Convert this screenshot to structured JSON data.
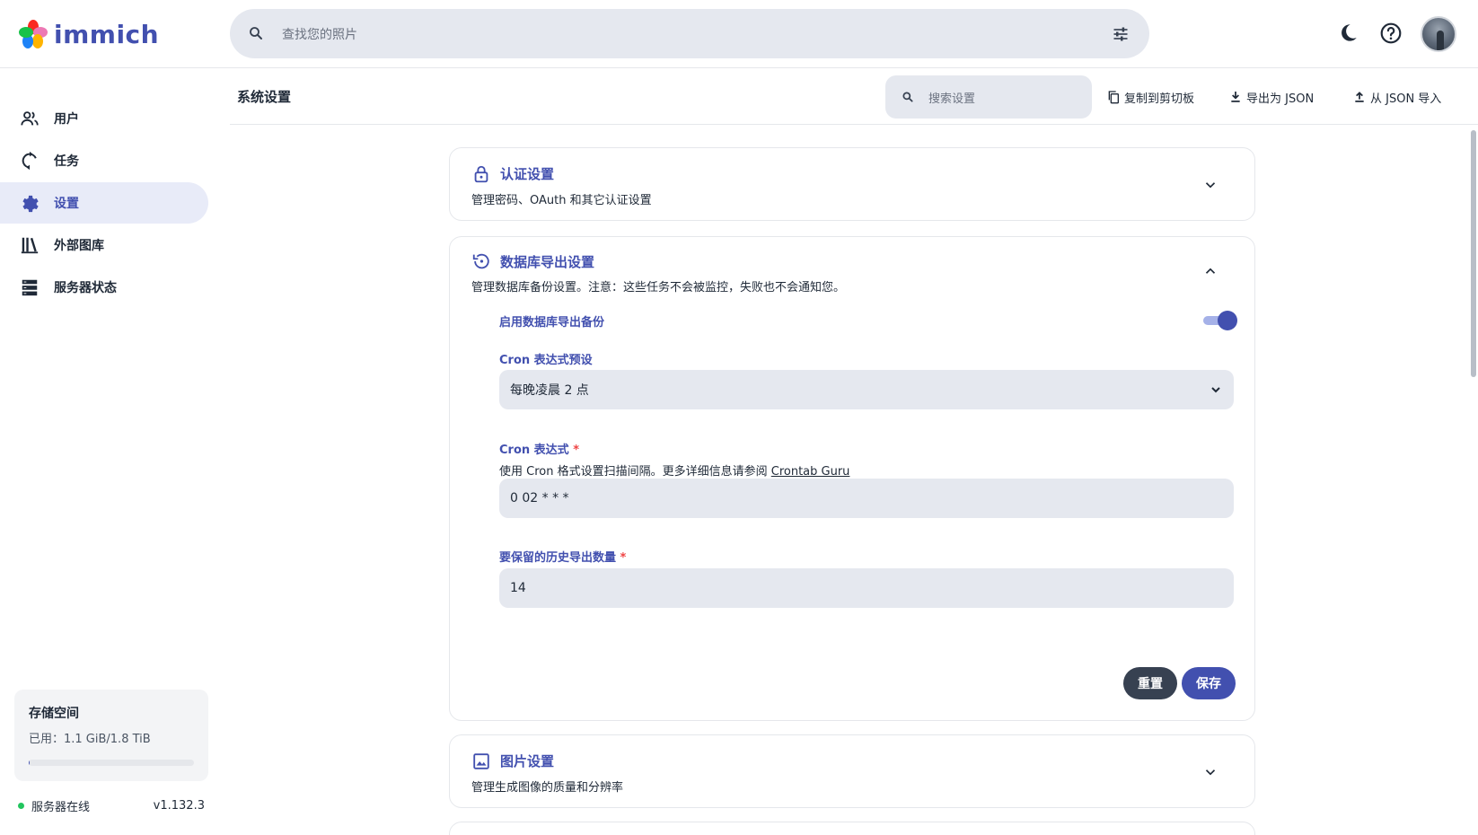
{
  "app": {
    "name": "immich"
  },
  "top_search": {
    "placeholder": "查找您的照片"
  },
  "sidebar": {
    "items": [
      {
        "label": "用户",
        "icon": "users-icon"
      },
      {
        "label": "任务",
        "icon": "sync-icon"
      },
      {
        "label": "设置",
        "icon": "gear-icon",
        "active": true
      },
      {
        "label": "外部图库",
        "icon": "library-icon"
      },
      {
        "label": "服务器状态",
        "icon": "server-icon"
      }
    ],
    "storage": {
      "title": "存储空间",
      "usage": "已用：1.1 GiB/1.8 TiB",
      "used_fraction": 0.0006
    },
    "server": {
      "status": "服务器在线",
      "version": "v1.132.3"
    }
  },
  "header": {
    "title": "系统设置",
    "search_placeholder": "搜索设置",
    "copy_label": "复制到剪切板",
    "export_label": "导出为 JSON",
    "import_label": "从 JSON 导入"
  },
  "sections": {
    "auth": {
      "title": "认证设置",
      "subtitle": "管理密码、OAuth 和其它认证设置",
      "expanded": false
    },
    "db_backup": {
      "title": "数据库导出设置",
      "subtitle": "管理数据库备份设置。注意：这些任务不会被监控，失败也不会通知您。",
      "expanded": true,
      "enable_label": "启用数据库导出备份",
      "enabled": true,
      "cron_preset_label": "Cron 表达式预设",
      "cron_preset_value": "每晚凌晨 2 点",
      "cron_label": "Cron 表达式",
      "required_mark": "*",
      "cron_desc": "使用 Cron 格式设置扫描间隔。更多详细信息请参阅",
      "cron_link": "Crontab Guru",
      "cron_value": "0 02 * * *",
      "keep_label": "要保留的历史导出数量",
      "keep_value": "14",
      "reset_label": "重置",
      "save_label": "保存"
    },
    "image": {
      "title": "图片设置",
      "subtitle": "管理生成图像的质量和分辨率",
      "expanded": false
    }
  },
  "colors": {
    "accent": "#4250af",
    "field_bg": "#e5e8ef",
    "online": "#22c55e"
  }
}
